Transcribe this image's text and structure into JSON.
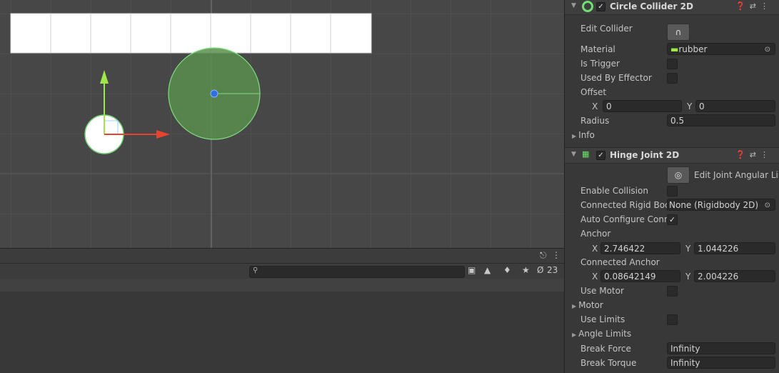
{
  "scene": {
    "panel_icons": {
      "lock": "lock-icon",
      "menu": "kebab-menu-icon"
    },
    "search": {
      "placeholder": ""
    },
    "toolbar_icons": [
      "scene-view-icon",
      "layer-icon",
      "tag-icon",
      "favorites-star-icon",
      "hidden-objects-icon"
    ],
    "hidden_count": "23",
    "colors": {
      "background": "#474747",
      "collider": "#5fd35f",
      "move_x": "#e8432e",
      "move_y": "#9ee64a"
    }
  },
  "circle_collider": {
    "title": "Circle Collider 2D",
    "enabled": true,
    "edit_collider_label": "Edit Collider",
    "material_label": "Material",
    "material_value": "rubber",
    "is_trigger_label": "Is Trigger",
    "is_trigger": false,
    "used_by_effector_label": "Used By Effector",
    "used_by_effector": false,
    "offset_label": "Offset",
    "offset_x": "0",
    "offset_y": "0",
    "radius_label": "Radius",
    "radius_value": "0.5",
    "info_label": "Info"
  },
  "hinge_joint": {
    "title": "Hinge Joint 2D",
    "enabled": true,
    "edit_limits_label": "Edit Joint Angular Lin",
    "enable_collision_label": "Enable Collision",
    "enable_collision": false,
    "connected_rb_label": "Connected Rigid Boc",
    "connected_rb_value": "None (Rigidbody 2D)",
    "auto_configure_label": "Auto Configure Conn",
    "auto_configure": true,
    "anchor_label": "Anchor",
    "anchor_x": "2.746422",
    "anchor_y": "1.044226",
    "connected_anchor_label": "Connected Anchor",
    "connected_anchor_x": "0.08642149",
    "connected_anchor_y": "2.004226",
    "use_motor_label": "Use Motor",
    "use_motor": false,
    "motor_label": "Motor",
    "use_limits_label": "Use Limits",
    "use_limits": false,
    "angle_limits_label": "Angle Limits",
    "break_force_label": "Break Force",
    "break_force_value": "Infinity",
    "break_torque_label": "Break Torque",
    "break_torque_value": "Infinity"
  },
  "axis_labels": {
    "x": "X",
    "y": "Y"
  },
  "glyphs": {
    "check": "✓",
    "target": "⊙",
    "fold_closed": "▶",
    "fold_open": "▼",
    "help": "❓",
    "preset": "⇄",
    "menu": "⋮"
  }
}
